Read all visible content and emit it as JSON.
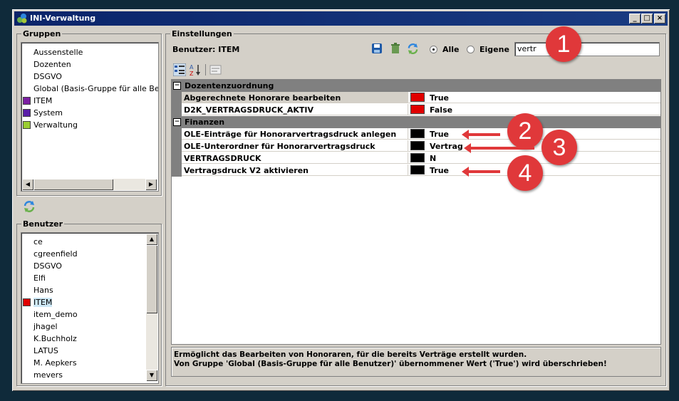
{
  "window": {
    "title": "INI-Verwaltung",
    "controls": [
      "_",
      "□",
      "×"
    ]
  },
  "groups": {
    "legend": "Gruppen",
    "items": [
      {
        "label": "Aussenstelle",
        "color": null
      },
      {
        "label": "Dozenten",
        "color": null
      },
      {
        "label": "DSGVO",
        "color": null
      },
      {
        "label": "Global (Basis-Gruppe für alle Benutzer)",
        "color": null
      },
      {
        "label": "ITEM",
        "color": "#7b1fa2"
      },
      {
        "label": "System",
        "color": "#5a1ea8"
      },
      {
        "label": "Verwaltung",
        "color": "#9acd32"
      }
    ]
  },
  "users": {
    "legend": "Benutzer",
    "selected": "ITEM",
    "items": [
      {
        "label": "ce",
        "color": null
      },
      {
        "label": "cgreenfield",
        "color": null
      },
      {
        "label": "DSGVO",
        "color": null
      },
      {
        "label": "Elfi",
        "color": null
      },
      {
        "label": "Hans",
        "color": null
      },
      {
        "label": "ITEM",
        "color": "#e00000"
      },
      {
        "label": "item_demo",
        "color": null
      },
      {
        "label": "jhagel",
        "color": null
      },
      {
        "label": "K.Buchholz",
        "color": null
      },
      {
        "label": "LATUS",
        "color": null
      },
      {
        "label": "M. Aepkers",
        "color": null
      },
      {
        "label": "mevers",
        "color": null
      }
    ]
  },
  "settings": {
    "legend": "Einstellungen",
    "user_label": "Benutzer: ITEM",
    "radio_all": "Alle",
    "radio_own": "Eigene",
    "radio_selected": "Alle",
    "search_value": "vertr",
    "toolbar_icons": [
      "save-icon",
      "delete-icon",
      "refresh-icon",
      "categorized-icon",
      "sort-az-icon",
      "property-pages-icon"
    ],
    "categories": [
      {
        "name": "Dozentenzuordnung",
        "properties": [
          {
            "name": "Abgerechnete Honorare bearbeiten",
            "value": "True",
            "color": "#e00000",
            "highlighted": true
          },
          {
            "name": "D2K_VERTRAGSDRUCK_AKTIV",
            "value": "False",
            "color": "#e00000",
            "highlighted": false
          }
        ]
      },
      {
        "name": "Finanzen",
        "properties": [
          {
            "name": "OLE-Einträge für Honorarvertragsdruck anlegen",
            "value": "True",
            "color": "#000000",
            "highlighted": false
          },
          {
            "name": "OLE-Unterordner für Honorarvertragsdruck",
            "value": "Vertrag",
            "color": "#000000",
            "highlighted": false
          },
          {
            "name": "VERTRAGSDRUCK",
            "value": "N",
            "color": "#000000",
            "highlighted": false
          },
          {
            "name": "Vertragsdruck V2 aktivieren",
            "value": "True",
            "color": "#000000",
            "highlighted": false
          }
        ]
      }
    ],
    "description_line1": "Ermöglicht das Bearbeiten von Honoraren, für die bereits Verträge erstellt wurden.",
    "description_line2": "Von Gruppe 'Global (Basis-Gruppe für alle Benutzer)' übernommener Wert ('True') wird überschrieben!"
  },
  "annotations": [
    "1",
    "2",
    "3",
    "4"
  ]
}
